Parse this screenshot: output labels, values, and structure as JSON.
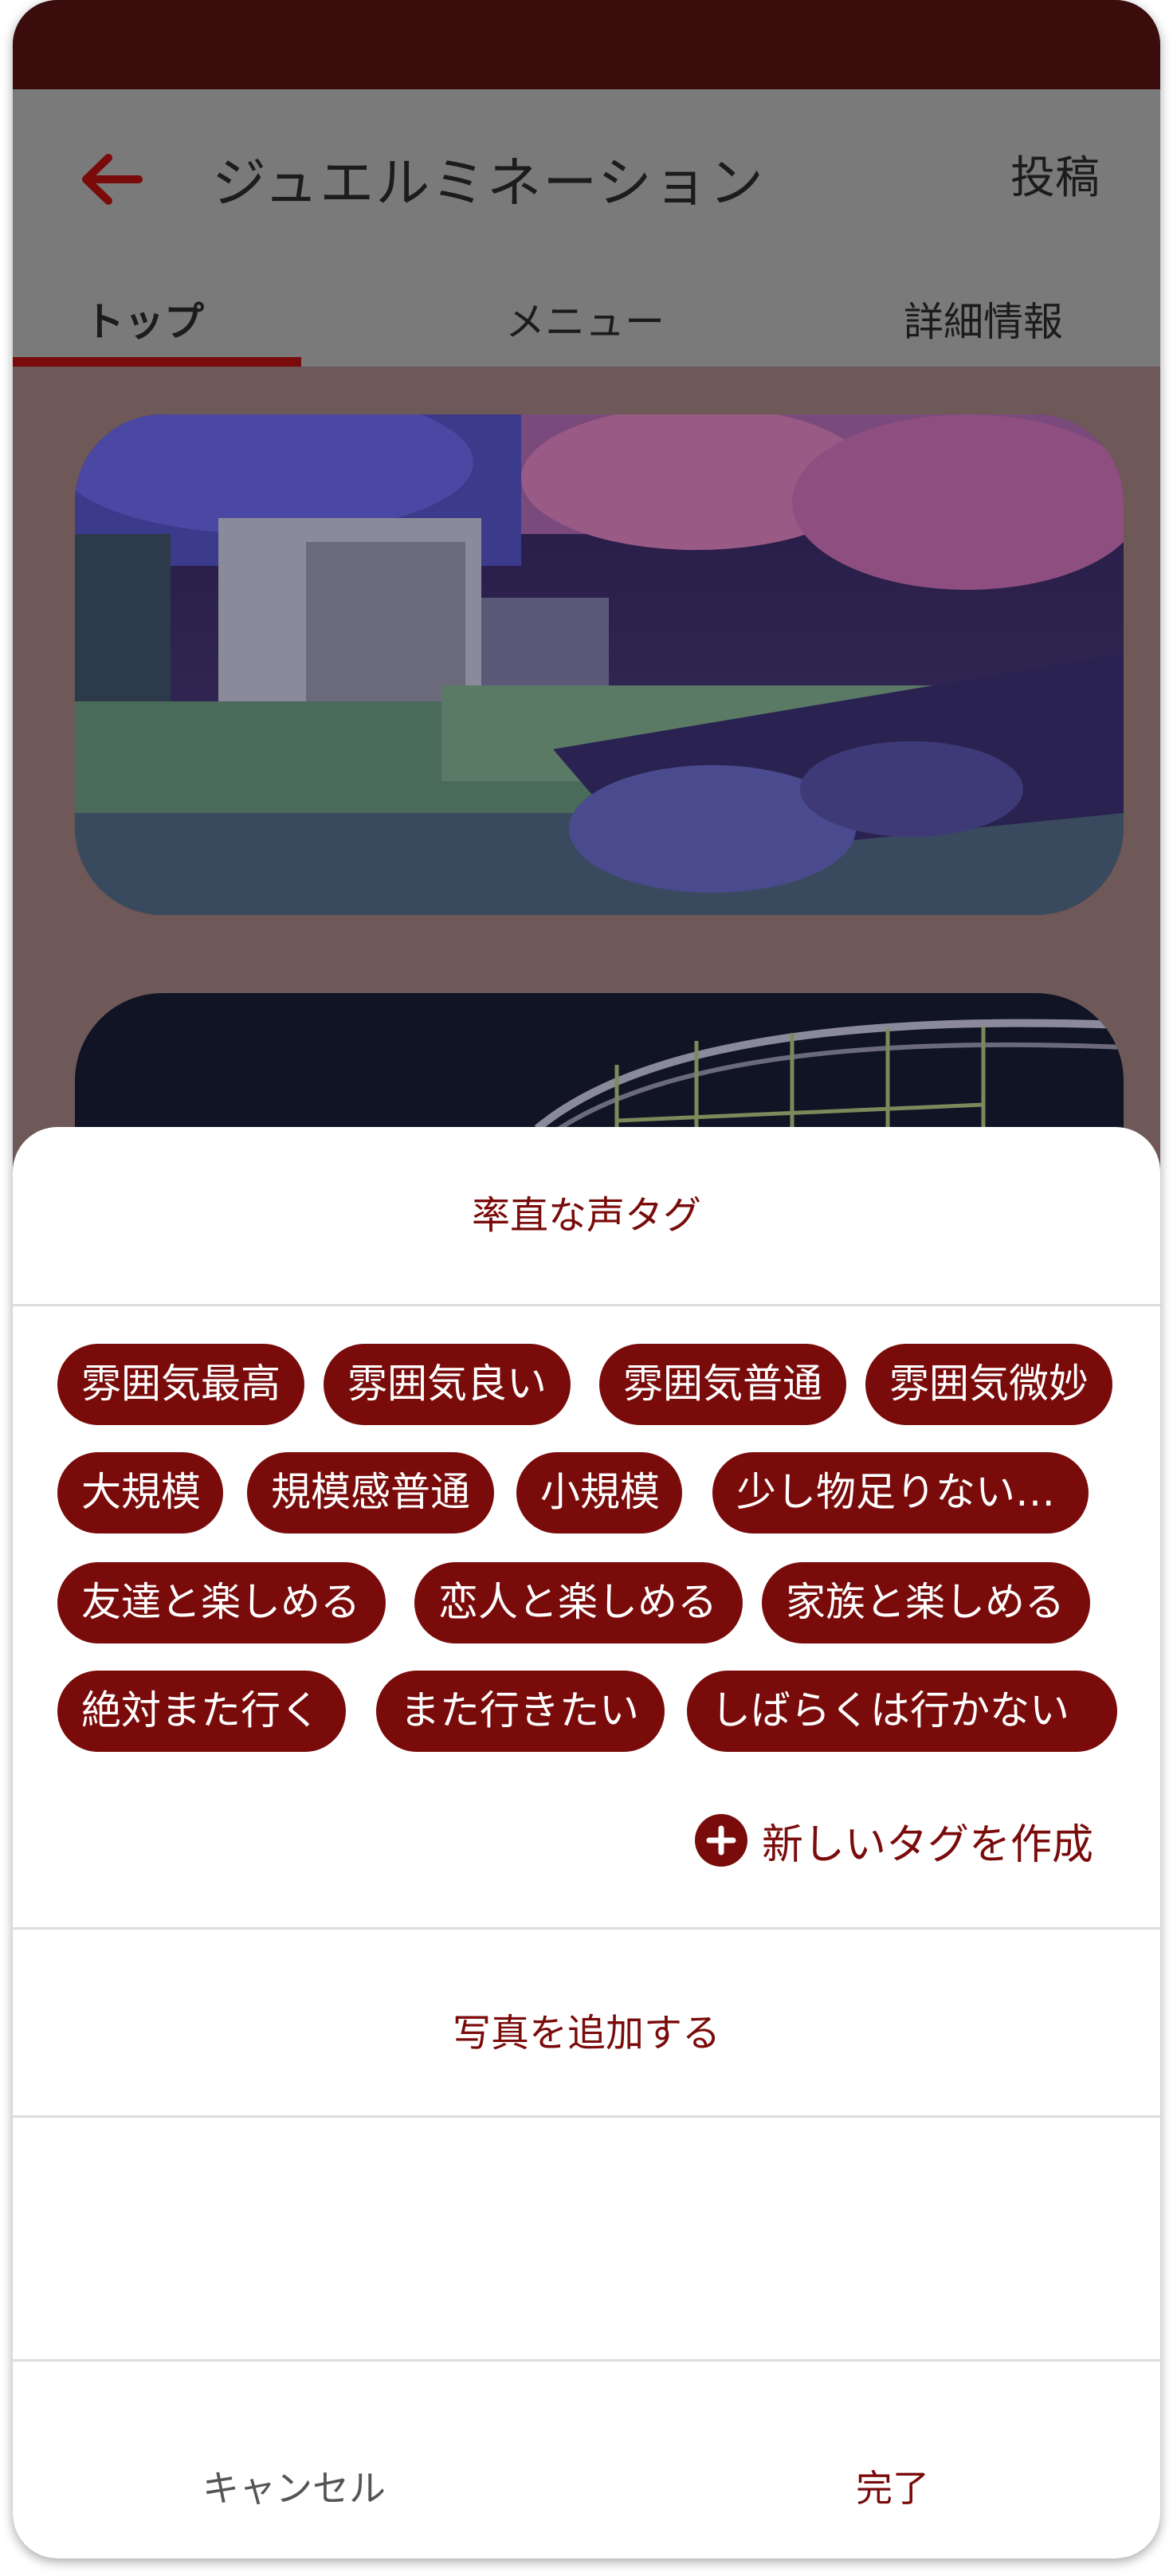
{
  "header": {
    "title": "ジュエルミネーション",
    "post_label": "投稿"
  },
  "tabs": [
    {
      "label": "トップ",
      "active": true
    },
    {
      "label": "メニュー",
      "active": false
    },
    {
      "label": "詳細情報",
      "active": false
    }
  ],
  "sheet": {
    "title": "率直な声タグ",
    "tags": [
      "雰囲気最高",
      "雰囲気良い",
      "雰囲気普通",
      "雰囲気微妙",
      "大規模",
      "規模感普通",
      "小規模",
      "少し物足りない…",
      "友達と楽しめる",
      "恋人と楽しめる",
      "家族と楽しめる",
      "絶対また行く",
      "また行きたい",
      "しばらくは行かない"
    ],
    "new_tag_label": "新しいタグを作成",
    "add_photo_label": "写真を追加する",
    "cancel_label": "キャンセル",
    "done_label": "完了"
  },
  "colors": {
    "accent": "#7a0b0b",
    "status_bar": "#3a0c0c",
    "app_bar": "#7a7a7a"
  }
}
